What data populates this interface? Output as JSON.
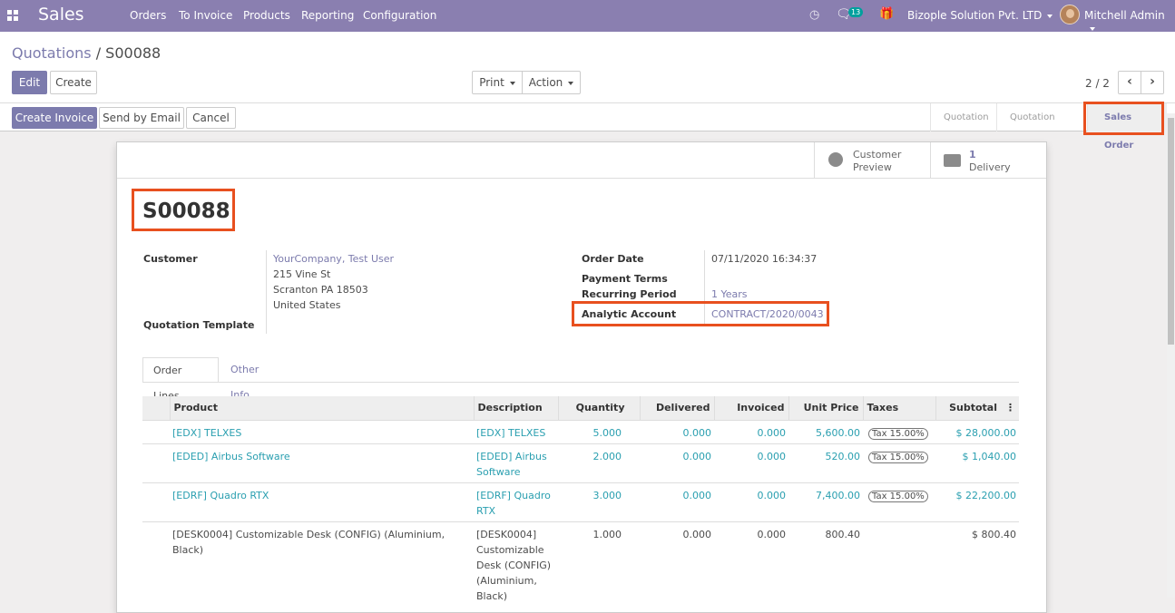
{
  "topbar": {
    "app": "Sales",
    "menu": [
      "Orders",
      "To Invoice",
      "Products",
      "Reporting",
      "Configuration"
    ],
    "chat_count": "13",
    "company": "Bizople Solution Pvt. LTD",
    "user": "Mitchell Admin"
  },
  "breadcrumb": {
    "parent": "Quotations",
    "sep": "/",
    "current": "S00088"
  },
  "buttons": {
    "edit": "Edit",
    "create": "Create",
    "print": "Print",
    "action": "Action",
    "create_invoice": "Create Invoice",
    "send_email": "Send by Email",
    "cancel": "Cancel"
  },
  "pager": "2 / 2",
  "status": [
    "Quotation",
    "Quotation Sent",
    "Sales Order"
  ],
  "smart": {
    "preview_l1": "Customer",
    "preview_l2": "Preview",
    "delivery_count": "1",
    "delivery_label": "Delivery"
  },
  "order": {
    "name": "S00088",
    "customer_label": "Customer",
    "customer": "YourCompany, Test User",
    "addr1": "215 Vine St",
    "addr2": "Scranton PA 18503",
    "addr3": "United States",
    "template_label": "Quotation Template",
    "date_label": "Order Date",
    "date": "07/11/2020 16:34:37",
    "terms_label": "Payment Terms",
    "period_label": "Recurring Period",
    "period": "1 Years",
    "analytic_label": "Analytic Account",
    "analytic": "CONTRACT/2020/0043"
  },
  "tabs": [
    "Order Lines",
    "Other Info"
  ],
  "table": {
    "headers": [
      "Product",
      "Description",
      "Quantity",
      "Delivered",
      "Invoiced",
      "Unit Price",
      "Taxes",
      "Subtotal"
    ],
    "rows": [
      {
        "product": "[EDX] TELXES",
        "desc": "[EDX] TELXES",
        "qty": "5.000",
        "del": "0.000",
        "inv": "0.000",
        "price": "5,600.00",
        "tax": "Tax 15.00%",
        "sub": "$ 28,000.00"
      },
      {
        "product": "[EDED] Airbus Software",
        "desc": "[EDED] Airbus Software",
        "qty": "2.000",
        "del": "0.000",
        "inv": "0.000",
        "price": "520.00",
        "tax": "Tax 15.00%",
        "sub": "$ 1,040.00"
      },
      {
        "product": "[EDRF] Quadro RTX",
        "desc": "[EDRF] Quadro RTX",
        "qty": "3.000",
        "del": "0.000",
        "inv": "0.000",
        "price": "7,400.00",
        "tax": "Tax 15.00%",
        "sub": "$ 22,200.00"
      },
      {
        "product": "[DESK0004] Customizable Desk (CONFIG) (Aluminium, Black)",
        "desc": "[DESK0004] Customizable Desk (CONFIG) (Aluminium, Black)",
        "qty": "1.000",
        "del": "0.000",
        "inv": "0.000",
        "price": "800.40",
        "tax": "",
        "sub": "$ 800.40"
      }
    ]
  }
}
